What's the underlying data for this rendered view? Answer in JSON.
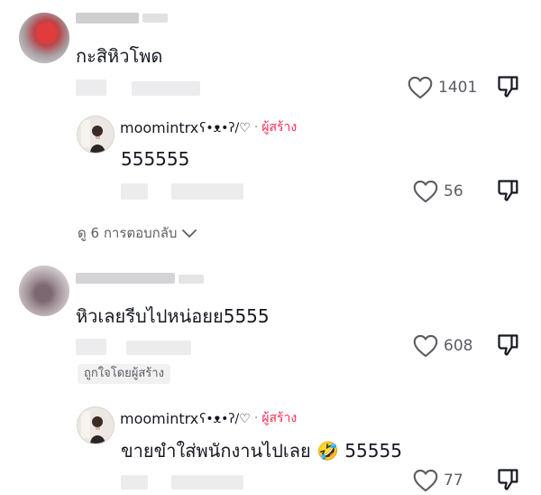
{
  "comments": [
    {
      "text": "กะสิหิวโพด",
      "likes": "1401",
      "reply": {
        "author": "moomintrx",
        "author_deco": "ʕ•ᴥ•ʔ/♡",
        "dot": "·",
        "creator_label": "ผู้สร้าง",
        "text": "555555",
        "likes": "56"
      },
      "view_replies": "ดู 6 การตอบกลับ"
    },
    {
      "text": "หิวเลยรีบไปหน่อยย5555",
      "likes": "608",
      "liked_by_creator": "ถูกใจโดยผู้สร้าง",
      "reply": {
        "author": "moomintrx",
        "author_deco": "ʕ•ᴥ•ʔ/♡",
        "dot": "·",
        "creator_label": "ผู้สร้าง",
        "text": "ขายขำใส่พนักงานไปเลย 🤣 55555",
        "likes": "77"
      }
    }
  ],
  "icons": {
    "like": "heart-outline-icon",
    "dislike": "thumbs-down-outline-icon",
    "chevron": "chevron-down-icon"
  },
  "colors": {
    "creator_accent": "#fe2c55",
    "muted_text": "#5b5c63",
    "text": "#161823"
  }
}
